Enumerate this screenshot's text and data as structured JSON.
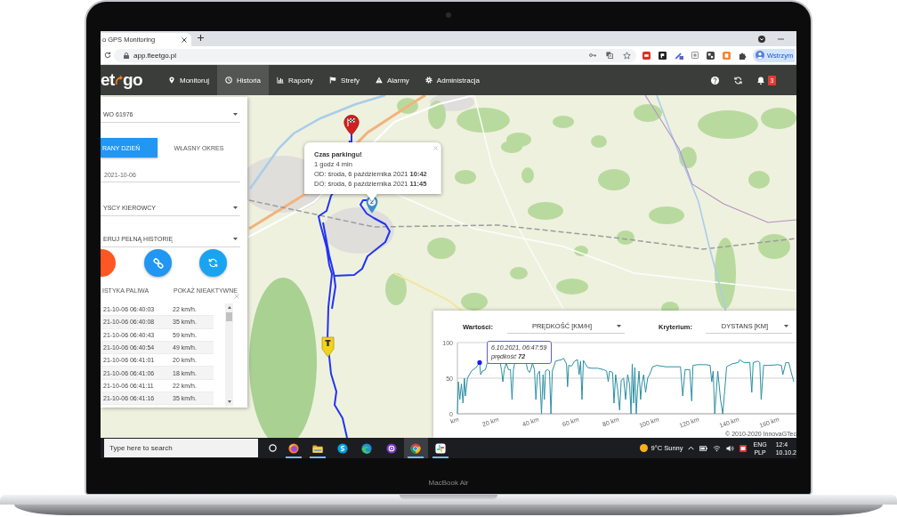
{
  "device": {
    "label": "MacBook Air"
  },
  "browser": {
    "tab_title": "o GPS Monitoring",
    "address": "app.fleetgo.pl",
    "profile_button": "Wstrzym"
  },
  "navbar": {
    "logo": {
      "left": "et",
      "right": "go"
    },
    "items": [
      {
        "label": "Monitoruj",
        "selected": false
      },
      {
        "label": "Historia",
        "selected": true
      },
      {
        "label": "Raporty",
        "selected": false
      },
      {
        "label": "Strefy",
        "selected": false
      },
      {
        "label": "Alarmy",
        "selected": false
      },
      {
        "label": "Administracja",
        "selected": false
      }
    ],
    "notification_count": "3"
  },
  "history_panel": {
    "vehicle_select": "WO 61976",
    "period_tabs": [
      {
        "label": "RANY DZIEŃ",
        "selected": true
      },
      {
        "label": "WŁASNY OKRES",
        "selected": false
      }
    ],
    "date_field": "2021-10-06",
    "driver_select": "YSCY KIEROWCY",
    "mode_select": "ERUJ PEŁNĄ HISTORIĘ",
    "action_labels": [
      "ISTYKA PALIWA",
      "POKAŻ NIEAKTYWNE"
    ],
    "rows": [
      {
        "time": "21-10-06 06:40:03",
        "speed": "22 km/h."
      },
      {
        "time": "21-10-06 06:40:08",
        "speed": "35 km/h."
      },
      {
        "time": "21-10-06 06:40:43",
        "speed": "59 km/h."
      },
      {
        "time": "21-10-06 06:40:54",
        "speed": "49 km/h."
      },
      {
        "time": "21-10-06 06:41:01",
        "speed": "20 km/h."
      },
      {
        "time": "21-10-06 06:41:06",
        "speed": "18 km/h."
      },
      {
        "time": "21-10-06 06:41:11",
        "speed": "22 km/h."
      },
      {
        "time": "21-10-06 06:41:16",
        "speed": "35 km/h."
      }
    ]
  },
  "map": {
    "markers": [
      {
        "kind": "finish"
      },
      {
        "kind": "stop",
        "label": "2"
      },
      {
        "kind": "start"
      }
    ],
    "parking_popup": {
      "title": "Czas parkingu!",
      "duration": "1 godz 4 min",
      "from": "OD: środa, 6 października 2021 **10:42**",
      "to": "DO: środa, 6 października 2021 **11:45**"
    }
  },
  "speed_panel": {
    "values_label": "Wartości:",
    "values_select": "PRĘDKOŚĆ [KM/H]",
    "criterion_label": "Kryterium:",
    "criterion_select": "DYSTANS [KM]",
    "chart_data": {
      "type": "line",
      "x": [
        0,
        0.5,
        1.2,
        2,
        2.8,
        3.5,
        4,
        5,
        6,
        7,
        9.3,
        11.1,
        11.6,
        12.5,
        14,
        14.8,
        21.4,
        22,
        22.7,
        23.4,
        24.4,
        25.5,
        26.5,
        27.3,
        28,
        28.6,
        34.4,
        35,
        36,
        36.6,
        37.5,
        38.5,
        39.2,
        40,
        41,
        42,
        42.8,
        43.4,
        44,
        45,
        46,
        46.7,
        47.4,
        49,
        52,
        53,
        54.5,
        55,
        55.6,
        57,
        58.5,
        60,
        60.8,
        61.5,
        62.2,
        62.9,
        65,
        67,
        70,
        73,
        74.5,
        75.3,
        76,
        77.5,
        78.2,
        79,
        80,
        81,
        81.8,
        83,
        84,
        85,
        86,
        86.7,
        87.3,
        88,
        88.6,
        89.3,
        90,
        90.7,
        91.5,
        92,
        93,
        94,
        95,
        96,
        97.5,
        99.6,
        104,
        108,
        111.4,
        112.5,
        113.7,
        116,
        117,
        117.6,
        120,
        124,
        126.2,
        127,
        127.7,
        128.5,
        130,
        131.4,
        132.5,
        133.7,
        134.4,
        137,
        140.3,
        141,
        143,
        146,
        147,
        147.7,
        150,
        151,
        151.7,
        152.9,
        156,
        160,
        161.8,
        162.5,
        164,
        165.5,
        167,
        168
      ],
      "series": [
        {
          "name": "prędkość",
          "color": "#2b8fa3",
          "values": [
            0,
            45,
            20,
            42,
            15,
            50,
            25,
            50,
            55,
            60,
            65,
            72,
            55,
            60,
            62,
            71,
            71,
            62,
            45,
            62,
            71,
            62,
            62,
            20,
            62,
            71,
            71,
            62,
            58,
            62,
            71,
            62,
            20,
            55,
            60,
            0,
            55,
            20,
            60,
            62,
            60,
            0,
            60,
            74,
            76,
            78,
            70,
            38,
            68,
            67,
            74,
            76,
            55,
            74,
            20,
            75,
            65,
            64,
            64,
            62,
            60,
            45,
            60,
            58,
            15,
            55,
            35,
            5,
            47,
            50,
            20,
            55,
            41,
            0,
            70,
            15,
            65,
            0,
            36,
            60,
            20,
            39,
            55,
            30,
            50,
            55,
            66,
            68,
            66,
            66,
            66,
            25,
            62,
            62,
            18,
            68,
            69,
            69,
            68,
            45,
            60,
            0,
            60,
            20,
            0,
            40,
            66,
            70,
            72,
            76,
            72,
            72,
            30,
            72,
            74,
            72,
            20,
            68,
            68,
            69,
            68,
            55,
            72,
            72,
            55,
            45
          ]
        }
      ],
      "xlim": [
        0,
        169.3
      ],
      "ylim": [
        0,
        100
      ],
      "xticks": [
        {
          "value": 0,
          "label": "km"
        },
        {
          "value": 20,
          "label": "20 km"
        },
        {
          "value": 40,
          "label": "40 km"
        },
        {
          "value": 60,
          "label": "60 km"
        },
        {
          "value": 80,
          "label": "80 km"
        },
        {
          "value": 100,
          "label": "100 km"
        },
        {
          "value": 120,
          "label": "120 km"
        },
        {
          "value": 140,
          "label": "140 km"
        },
        {
          "value": 160,
          "label": "160 km"
        }
      ],
      "yticks": [
        0,
        50,
        100
      ],
      "annotations": [
        {
          "x": 11.1,
          "y": 72,
          "text": "6.10.2021, 06:47:59"
        }
      ]
    },
    "tooltip_value": "72",
    "copyright": "© 2010-2020 InnovaGTec"
  },
  "taskbar": {
    "search": {
      "placeholder": "Type here to search"
    },
    "apps": [
      {
        "running": true,
        "selected": false
      },
      {
        "running": true,
        "selected": false
      },
      {
        "running": false,
        "selected": false
      },
      {
        "running": false,
        "selected": false
      },
      {
        "running": false,
        "selected": false
      },
      {
        "running": true,
        "selected": true
      },
      {
        "running": true,
        "selected": false
      }
    ],
    "weather": "9°C Sunny",
    "language": {
      "input": "ENG",
      "layout": "PLP"
    },
    "clock": {
      "time": "12:4",
      "date": "10.10.2"
    }
  }
}
